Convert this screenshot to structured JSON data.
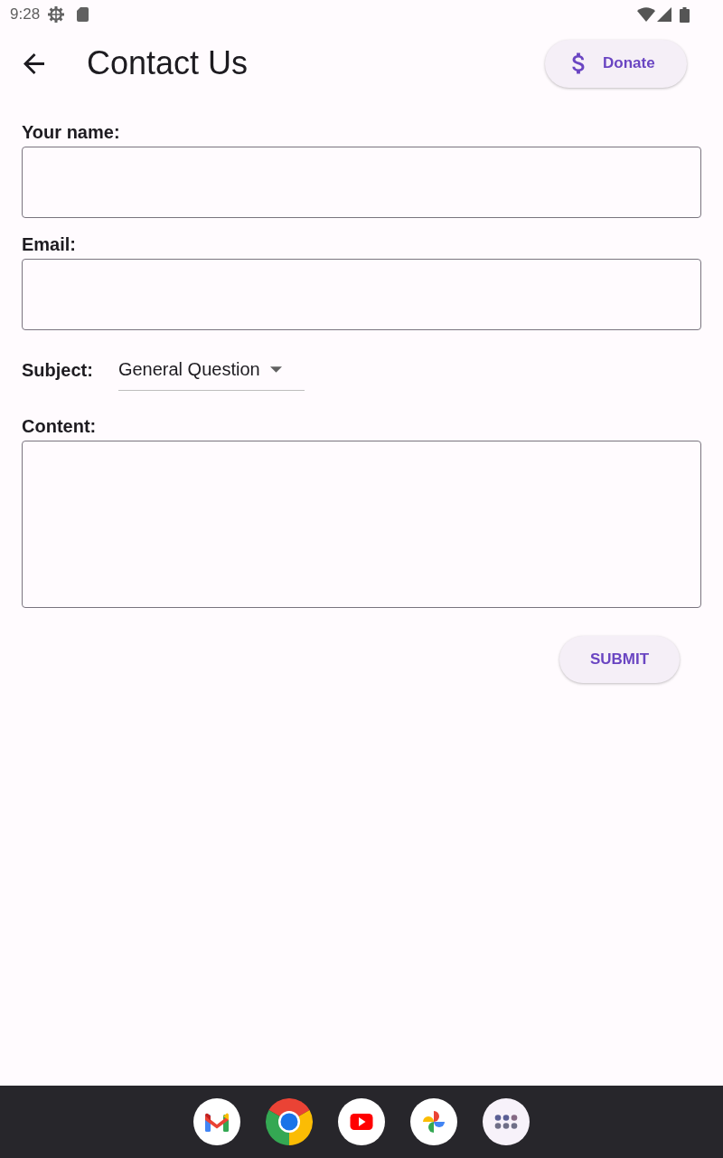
{
  "status_bar": {
    "time": "9:28"
  },
  "app_bar": {
    "title": "Contact Us",
    "action_button": {
      "label": "Donate"
    }
  },
  "form": {
    "fields": [
      {
        "kind": "text",
        "label": "Your name:"
      },
      {
        "kind": "text",
        "label": "Email:"
      },
      {
        "kind": "dropdown",
        "label": "Subject:",
        "value": "General Question"
      },
      {
        "kind": "multiline",
        "label": "Content:"
      }
    ],
    "submit_button": {
      "label": "SUBMIT"
    }
  }
}
